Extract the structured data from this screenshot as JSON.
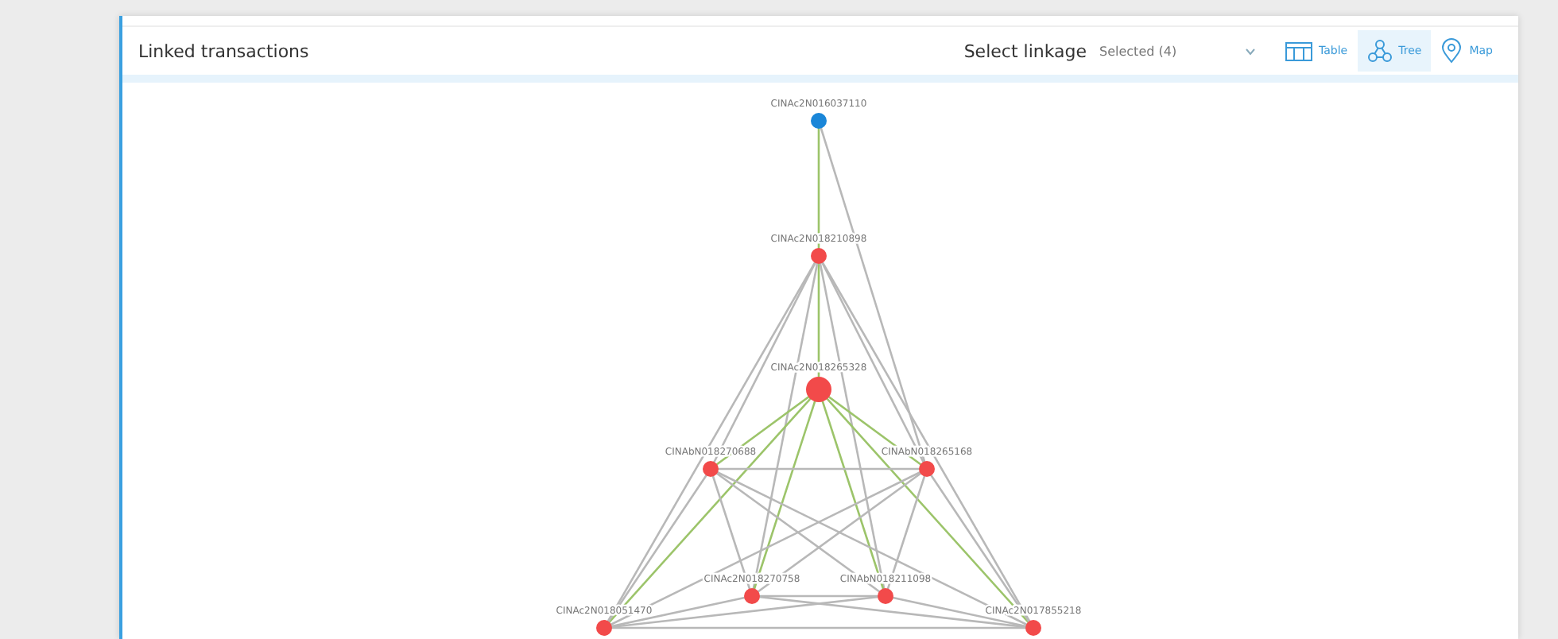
{
  "panel": {
    "title": "Linked transactions"
  },
  "linkage": {
    "label": "Select linkage",
    "value": "Selected (4)"
  },
  "views": [
    {
      "label": "Table",
      "selected": false
    },
    {
      "label": "Tree",
      "selected": true
    },
    {
      "label": "Map",
      "selected": false
    }
  ],
  "graph": {
    "nodes": [
      {
        "label": "CINAc2N016037110",
        "color": "#1a86d8",
        "kind": "node"
      },
      {
        "label": "CINAc2N018210898",
        "color": "#f24a4a",
        "kind": "node"
      },
      {
        "label": "CINAc2N018265328",
        "color": "#f24a4a",
        "kind": "focus"
      },
      {
        "label": "CINAbN018270688",
        "color": "#f24a4a",
        "kind": "node"
      },
      {
        "label": "CINAbN018265168",
        "color": "#f24a4a",
        "kind": "node"
      },
      {
        "label": "CINAc2N018270758",
        "color": "#f24a4a",
        "kind": "node"
      },
      {
        "label": "CINAbN018211098",
        "color": "#f24a4a",
        "kind": "node"
      },
      {
        "label": "CINAc2N018051470",
        "color": "#f24a4a",
        "kind": "node"
      },
      {
        "label": "CINAc2N017855218",
        "color": "#f24a4a",
        "kind": "node"
      }
    ]
  }
}
